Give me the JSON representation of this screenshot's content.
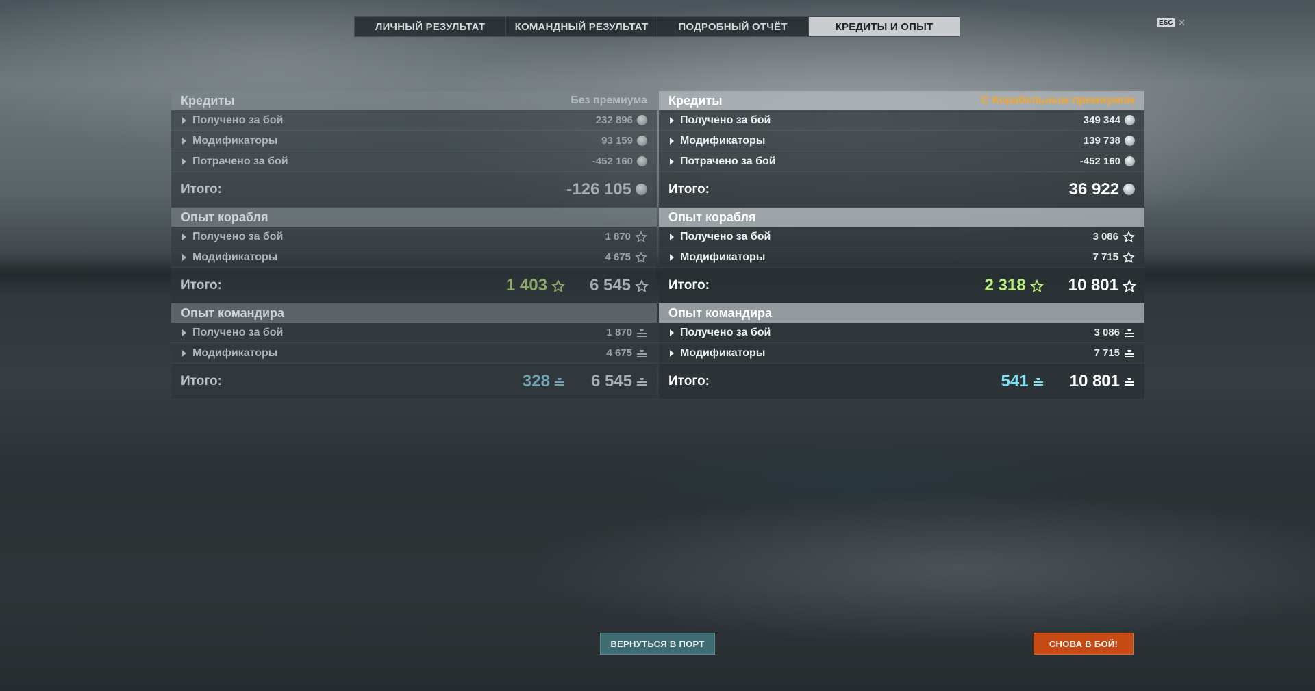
{
  "tabs": [
    {
      "label": "ЛИЧНЫЙ РЕЗУЛЬТАТ"
    },
    {
      "label": "КОМАНДНЫЙ РЕЗУЛЬТАТ"
    },
    {
      "label": "ПОДРОБНЫЙ ОТЧЁТ"
    },
    {
      "label": "КРЕДИТЫ И ОПЫТ"
    }
  ],
  "active_tab": "КРЕДИТЫ И ОПЫТ",
  "esc": {
    "key": "ESC",
    "close": "✕"
  },
  "left": {
    "credits": {
      "title": "Кредиты",
      "note": "Без премиума",
      "rows": [
        {
          "label": "Получено за бой",
          "value": "232 896"
        },
        {
          "label": "Модификаторы",
          "value": "93 159"
        },
        {
          "label": "Потрачено за бой",
          "value": "-452 160"
        }
      ],
      "total_label": "Итого:",
      "total": "-126 105"
    },
    "ship_xp": {
      "title": "Опыт корабля",
      "rows": [
        {
          "label": "Получено за бой",
          "value": "1 870"
        },
        {
          "label": "Модификаторы",
          "value": "4 675"
        }
      ],
      "total_label": "Итого:",
      "free": "1 403",
      "total": "6 545"
    },
    "cmdr_xp": {
      "title": "Опыт командира",
      "rows": [
        {
          "label": "Получено за бой",
          "value": "1 870"
        },
        {
          "label": "Модификаторы",
          "value": "4 675"
        }
      ],
      "total_label": "Итого:",
      "elite": "328",
      "total": "6 545"
    }
  },
  "right": {
    "credits": {
      "title": "Кредиты",
      "note": "С Корабельным премиумом",
      "rows": [
        {
          "label": "Получено за бой",
          "value": "349 344"
        },
        {
          "label": "Модификаторы",
          "value": "139 738"
        },
        {
          "label": "Потрачено за бой",
          "value": "-452 160"
        }
      ],
      "total_label": "Итого:",
      "total": "36 922"
    },
    "ship_xp": {
      "title": "Опыт корабля",
      "rows": [
        {
          "label": "Получено за бой",
          "value": "3 086"
        },
        {
          "label": "Модификаторы",
          "value": "7 715"
        }
      ],
      "total_label": "Итого:",
      "free": "2 318",
      "total": "10 801"
    },
    "cmdr_xp": {
      "title": "Опыт командира",
      "rows": [
        {
          "label": "Получено за бой",
          "value": "3 086"
        },
        {
          "label": "Модификаторы",
          "value": "7 715"
        }
      ],
      "total_label": "Итого:",
      "elite": "541",
      "total": "10 801"
    }
  },
  "buttons": {
    "port": "ВЕРНУТЬСЯ В ПОРТ",
    "battle": "СНОВА В БОЙ!"
  },
  "colors": {
    "premium_note": "#f2a72e",
    "free_xp": "#b8f07a",
    "elite_xp": "#7fe2f2",
    "battle_button": "#c64a14",
    "port_button": "#3f6b72"
  },
  "icons": {
    "credits": "silver-coin-icon",
    "ship_xp": "star-icon",
    "free_xp": "star-icon",
    "cmdr_xp": "commander-xp-icon",
    "expand": "triangle-right-icon"
  }
}
